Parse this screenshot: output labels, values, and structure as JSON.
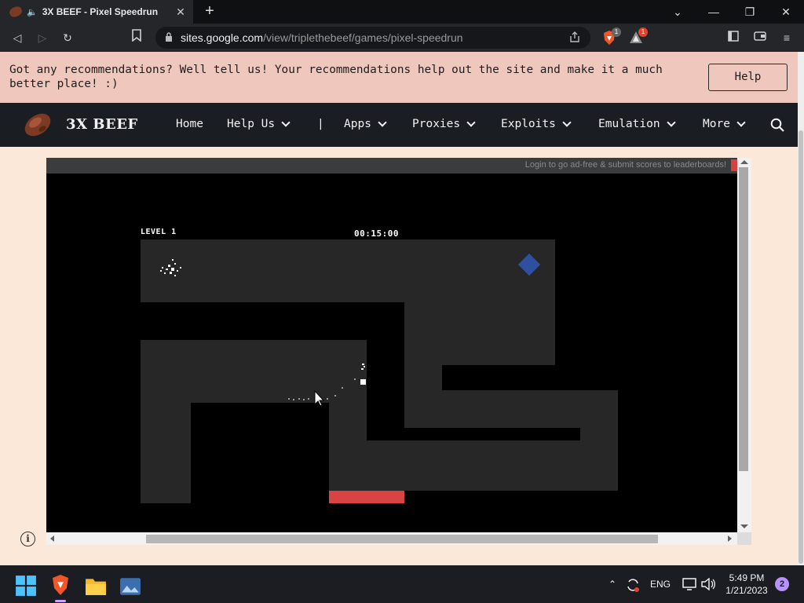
{
  "browser": {
    "tab": {
      "title": "3X BEEF - Pixel Speedrun",
      "close_glyph": "✕",
      "audio_glyph": "🔈",
      "favicon": "beef-icon"
    },
    "new_tab_glyph": "+",
    "window_controls": {
      "minimize": "—",
      "maximize": "❐",
      "close": "✕",
      "tablist": "⌄"
    },
    "nav": {
      "back": "◁",
      "forward": "▷",
      "reload": "↻",
      "bookmark": "⊡"
    },
    "address": {
      "host": "sites.google.com",
      "path": "/view/triplethebeef/games/pixel-speedrun",
      "lock": "🔒",
      "share": "⇪"
    },
    "extensions": {
      "brave_shield_count": "1",
      "brave_rewards_count": "1"
    },
    "right_icons": {
      "sidebar": "▯",
      "wallet": "▭",
      "menu": "≡"
    }
  },
  "banner": {
    "text": "Got any recommendations? Well tell us! Your recommendations help out the site and make it a much better place! :)",
    "button": "Help"
  },
  "site_nav": {
    "title": "3X BEEF",
    "items": [
      {
        "label": "Home",
        "dropdown": false
      },
      {
        "label": "Help Us",
        "dropdown": true
      },
      {
        "label": "|",
        "dropdown": false
      },
      {
        "label": "Apps",
        "dropdown": true
      },
      {
        "label": "Proxies",
        "dropdown": true
      },
      {
        "label": "Exploits",
        "dropdown": true
      },
      {
        "label": "Emulation",
        "dropdown": true
      },
      {
        "label": "More",
        "dropdown": true
      }
    ]
  },
  "game": {
    "login_text": "Login to go ad-free & submit scores to leaderboards!",
    "level": "LEVEL 1",
    "timer": "00:15:00",
    "colors": {
      "wall": "#272727",
      "background": "#000000",
      "goal": "#2f4fa0",
      "hazard": "#d94343",
      "player": "#ffffff"
    }
  },
  "info_glyph": "i",
  "taskbar": {
    "apps": [
      "start-icon",
      "brave-browser-icon",
      "file-explorer-icon",
      "photos-icon"
    ],
    "tray": {
      "chevron": "⌃",
      "language": "ENG"
    },
    "clock": {
      "time": "5:49 PM",
      "date": "1/21/2023"
    },
    "notifications": "2"
  }
}
